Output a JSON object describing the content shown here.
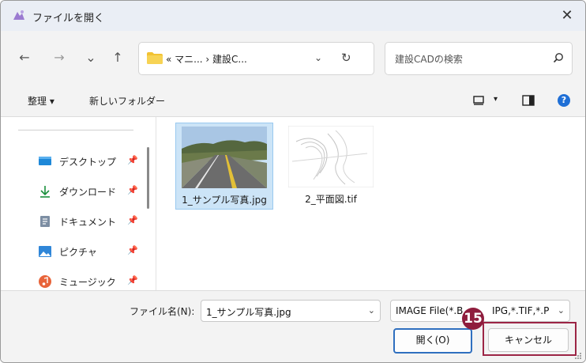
{
  "window": {
    "title": "ファイルを開く",
    "close_glyph": "✕"
  },
  "nav": {
    "back_glyph": "←",
    "forward_glyph": "→",
    "recent_glyph": "⌄",
    "up_glyph": "↑",
    "address_text": "« マニ... › 建設C...",
    "address_chevron": "⌄",
    "refresh_glyph": "↻",
    "search_placeholder": "建設CADの検索"
  },
  "commandbar": {
    "organize_label": "整理 ▾",
    "new_folder_label": "新しいフォルダー",
    "view_dropdown_glyph": "▾",
    "help_glyph": "?"
  },
  "sidebar": {
    "items": [
      {
        "label": "デスクトップ",
        "icon": "desktop-icon"
      },
      {
        "label": "ダウンロード",
        "icon": "download-icon"
      },
      {
        "label": "ドキュメント",
        "icon": "document-icon"
      },
      {
        "label": "ピクチャ",
        "icon": "pictures-icon"
      },
      {
        "label": "ミュージック",
        "icon": "music-icon"
      }
    ],
    "pin_glyph": "📌"
  },
  "files": [
    {
      "name": "1_サンプル写真.jpg",
      "selected": true
    },
    {
      "name": "2_平面図.tif",
      "selected": false
    }
  ],
  "footer": {
    "filename_label": "ファイル名(N):",
    "filename_value": "1_サンプル写真.jpg",
    "filter_value": "IMAGE File(*.B",
    "filter_value_tail": "IPG,*.TIF,*.P",
    "open_label": "開く(O)",
    "cancel_label": "キャンセル"
  },
  "annotation": {
    "step_number": "15",
    "color": "#8f1d3d"
  },
  "colors": {
    "accent": "#2f6fbf",
    "selection": "#cce4f7",
    "titlebar": "#eaeef5"
  }
}
